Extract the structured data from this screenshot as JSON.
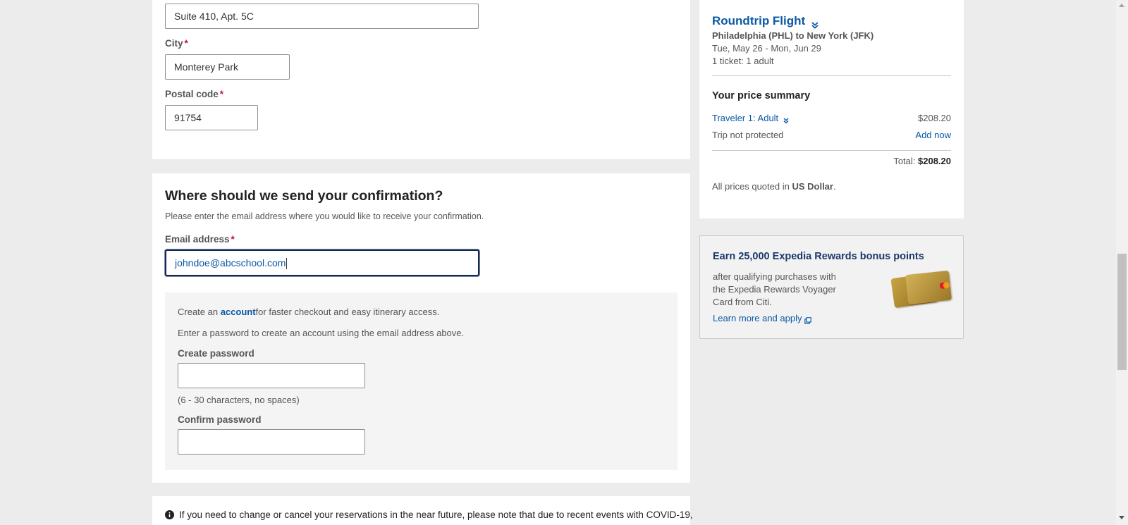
{
  "address": {
    "line2_value": "Suite 410, Apt. 5C",
    "city_label": "City",
    "city_value": "Monterey Park",
    "postal_label": "Postal code",
    "postal_value": "91754",
    "required_mark": "*"
  },
  "confirmation": {
    "title": "Where should we send your confirmation?",
    "subtitle": "Please enter the email address where you would like to receive your confirmation.",
    "email_label": "Email address",
    "email_value": "johndoe@abcschool.com",
    "account_prefix": "Create an ",
    "account_link": "account",
    "account_suffix": "for faster checkout and easy itinerary access.",
    "password_intro": "Enter a password to create an account using the email address above.",
    "create_password_label": "Create password",
    "password_hint": "(6 - 30 characters, no spaces)",
    "confirm_password_label": "Confirm password"
  },
  "covid": {
    "icon": "info-icon",
    "text": "If you need to change or cancel your reservations in the near future, please note that due to recent events with COVID-19,"
  },
  "summary": {
    "trip_title": "Roundtrip Flight",
    "route": "Philadelphia (PHL) to New York (JFK)",
    "dates": "Tue, May 26 - Mon, Jun 29",
    "tickets": "1 ticket: 1 adult",
    "price_title": "Your price summary",
    "traveler_label": "Traveler 1: Adult",
    "traveler_price": "$208.20",
    "protection_label": "Trip not protected",
    "protection_action": "Add now",
    "total_label": "Total: ",
    "total_value": "$208.20",
    "currency_prefix": "All prices quoted in ",
    "currency_value": "US Dollar",
    "currency_suffix": "."
  },
  "rewards": {
    "title": "Earn 25,000 Expedia Rewards bonus points",
    "line1": "after qualifying purchases with",
    "line2": "the Expedia Rewards Voyager",
    "line3": "Card from Citi.",
    "link": "Learn more and apply"
  },
  "colors": {
    "link": "#0b59a5",
    "required": "#c8102e",
    "rewards_title": "#1a3a6b",
    "background": "#ececec"
  }
}
